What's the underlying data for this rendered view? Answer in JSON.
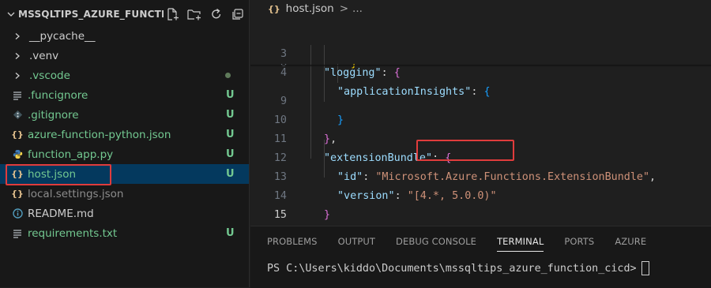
{
  "explorer": {
    "title": "MSSQLTIPS_AZURE_FUNCTI...",
    "actions": [
      "new-file-icon",
      "new-folder-icon",
      "refresh-icon",
      "collapse-all-icon"
    ],
    "items": [
      {
        "name": "__pycache__",
        "kind": "folder",
        "status": ""
      },
      {
        "name": ".venv",
        "kind": "folder",
        "status": ""
      },
      {
        "name": ".vscode",
        "kind": "folder",
        "status": "dot"
      },
      {
        "name": ".funcignore",
        "kind": "lines",
        "status": "U"
      },
      {
        "name": ".gitignore",
        "kind": "git",
        "status": "U"
      },
      {
        "name": "azure-function-python.json",
        "kind": "json",
        "status": "U"
      },
      {
        "name": "function_app.py",
        "kind": "python",
        "status": "U"
      },
      {
        "name": "host.json",
        "kind": "json",
        "status": "U"
      },
      {
        "name": "local.settings.json",
        "kind": "json",
        "status": ""
      },
      {
        "name": "README.md",
        "kind": "info",
        "status": ""
      },
      {
        "name": "requirements.txt",
        "kind": "lines",
        "status": "U"
      }
    ],
    "selected": "host.json"
  },
  "editor": {
    "breadcrumb_file": "host.json",
    "breadcrumb_sep": ">",
    "breadcrumb_more": "...",
    "lines": [
      {
        "no": "3",
        "k1": "\"logging\"",
        "p1": ": ",
        "br": "{"
      },
      {
        "no": "4",
        "k1": "\"applicationInsights\"",
        "p1": ": ",
        "br": "{"
      },
      {
        "no": "8",
        "br": "}"
      },
      {
        "no": "9",
        "br": "}"
      },
      {
        "no": "10",
        "br": "}",
        "p1": ","
      },
      {
        "no": "11",
        "k1": "\"extensionBundle\"",
        "p1": ": ",
        "br": "{"
      },
      {
        "no": "12",
        "k1": "\"id\"",
        "p1": ": ",
        "s1": "\"Microsoft.Azure.Functions.ExtensionBundle\"",
        "p2": ","
      },
      {
        "no": "13",
        "k1": "\"version\"",
        "p1": ": ",
        "s0": "\"",
        "s1": "[4.*, 5.0.0)",
        "s2": "\""
      },
      {
        "no": "14",
        "br": "}"
      },
      {
        "no": "15",
        "br": "}"
      }
    ]
  },
  "panel": {
    "tabs": [
      "PROBLEMS",
      "OUTPUT",
      "DEBUG CONSOLE",
      "TERMINAL",
      "PORTS",
      "AZURE"
    ],
    "active_tab": "TERMINAL",
    "terminal_prompt": "PS C:\\Users\\kiddo\\Documents\\mssqltips_azure_function_cicd>"
  },
  "colors": {
    "status_untracked": "#73c991",
    "json_icon": "#e2c08d",
    "highlight_box": "#e03c3c",
    "selection": "#04395e"
  }
}
